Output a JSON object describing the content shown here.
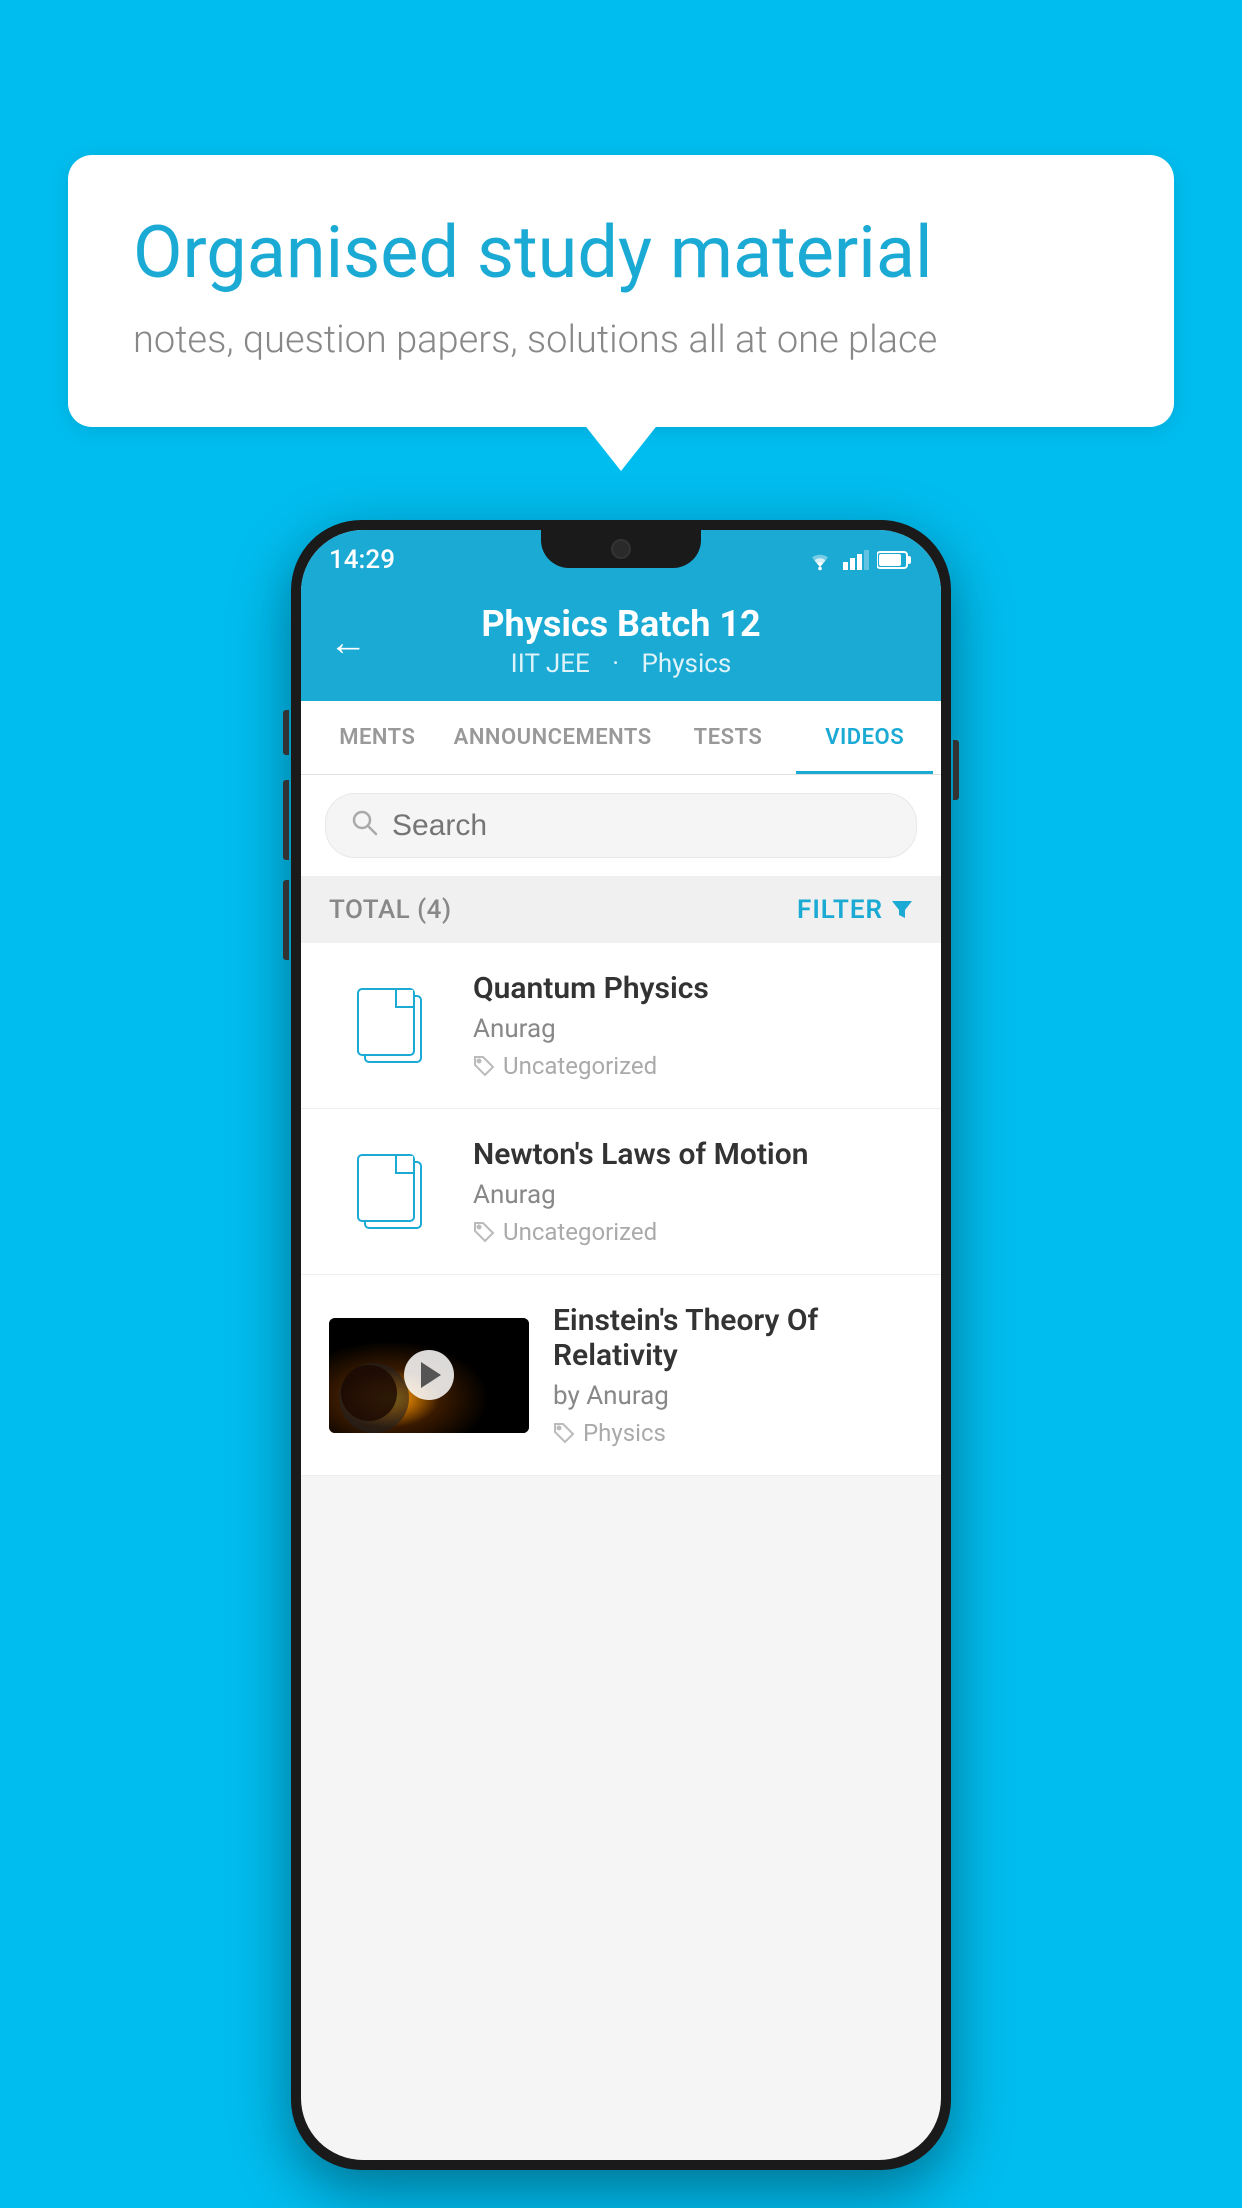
{
  "background": {
    "color": "#00BDEF"
  },
  "speech_bubble": {
    "heading": "Organised study material",
    "subtext": "notes, question papers, solutions all at one place"
  },
  "phone": {
    "status_bar": {
      "time": "14:29"
    },
    "header": {
      "title": "Physics Batch 12",
      "subtitle_tag1": "IIT JEE",
      "subtitle_tag2": "Physics",
      "back_label": "←"
    },
    "tabs": [
      {
        "label": "MENTS",
        "active": false
      },
      {
        "label": "ANNOUNCEMENTS",
        "active": false
      },
      {
        "label": "TESTS",
        "active": false
      },
      {
        "label": "VIDEOS",
        "active": true
      }
    ],
    "search": {
      "placeholder": "Search"
    },
    "filter_bar": {
      "total_label": "TOTAL (4)",
      "filter_label": "FILTER"
    },
    "videos": [
      {
        "id": 1,
        "title": "Quantum Physics",
        "author": "Anurag",
        "tag": "Uncategorized",
        "has_thumb": false
      },
      {
        "id": 2,
        "title": "Newton's Laws of Motion",
        "author": "Anurag",
        "tag": "Uncategorized",
        "has_thumb": false
      },
      {
        "id": 3,
        "title": "Einstein's Theory Of Relativity",
        "author": "by Anurag",
        "tag": "Physics",
        "has_thumb": true
      }
    ]
  }
}
